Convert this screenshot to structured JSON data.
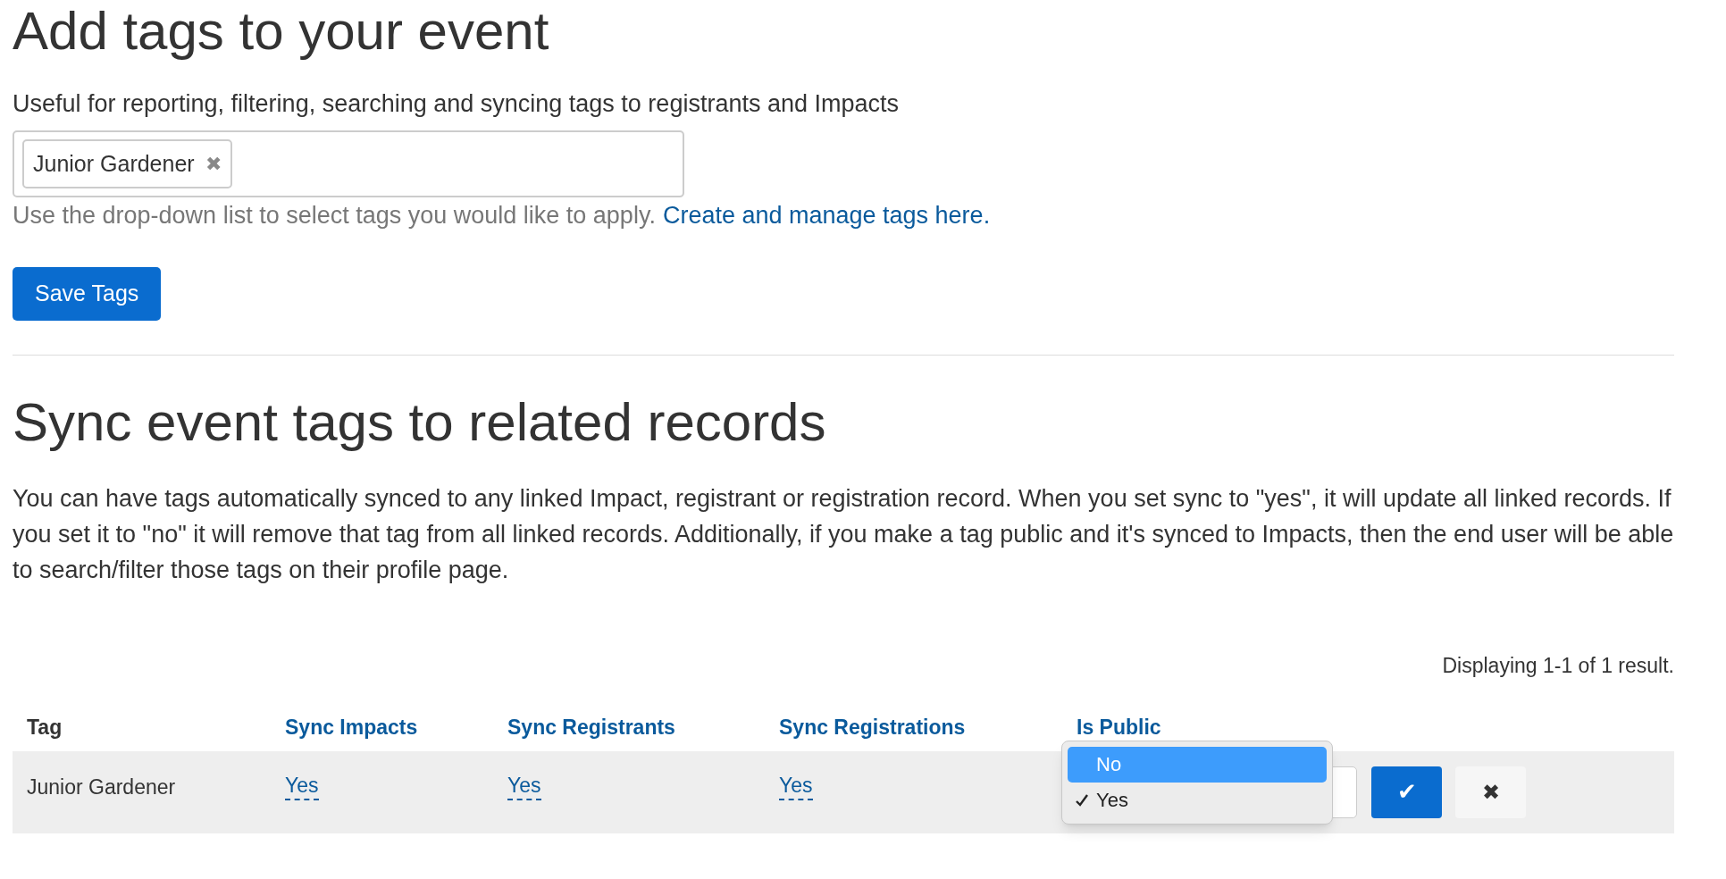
{
  "tags_section": {
    "title": "Add tags to your event",
    "description": "Useful for reporting, filtering, searching and syncing tags to registrants and Impacts",
    "tag_field": {
      "chips": [
        {
          "label": "Junior Gardener",
          "remove": "✖"
        }
      ]
    },
    "help_text": "Use the drop-down list to select tags you would like to apply.",
    "help_link": "Create and manage tags here.",
    "save_button": "Save Tags"
  },
  "sync_section": {
    "title": "Sync event tags to related records",
    "description": "You can have tags automatically synced to any linked Impact, registrant or registration record. When you set sync to \"yes\", it will update all linked records. If you set it to \"no\" it will remove that tag from all linked records. Additionally, if you make a tag public and it's synced to Impacts, then the end user will be able to search/filter those tags on their profile page.",
    "result_count": "Displaying 1-1 of 1 result.",
    "table": {
      "columns": [
        {
          "label": "Tag",
          "sortable": false
        },
        {
          "label": "Sync Impacts",
          "sortable": true
        },
        {
          "label": "Sync Registrants",
          "sortable": true
        },
        {
          "label": "Sync Registrations",
          "sortable": true
        },
        {
          "label": "Is Public",
          "sortable": true
        }
      ],
      "rows": [
        {
          "tag": "Junior Gardener",
          "sync_impacts": "Yes",
          "sync_registrants": "Yes",
          "sync_registrations": "Yes",
          "is_public_options": [
            {
              "label": "No",
              "highlighted": true,
              "checked": false
            },
            {
              "label": "Yes",
              "highlighted": false,
              "checked": true
            }
          ],
          "confirm_icon": "✔",
          "cancel_icon": "✖"
        }
      ]
    }
  }
}
